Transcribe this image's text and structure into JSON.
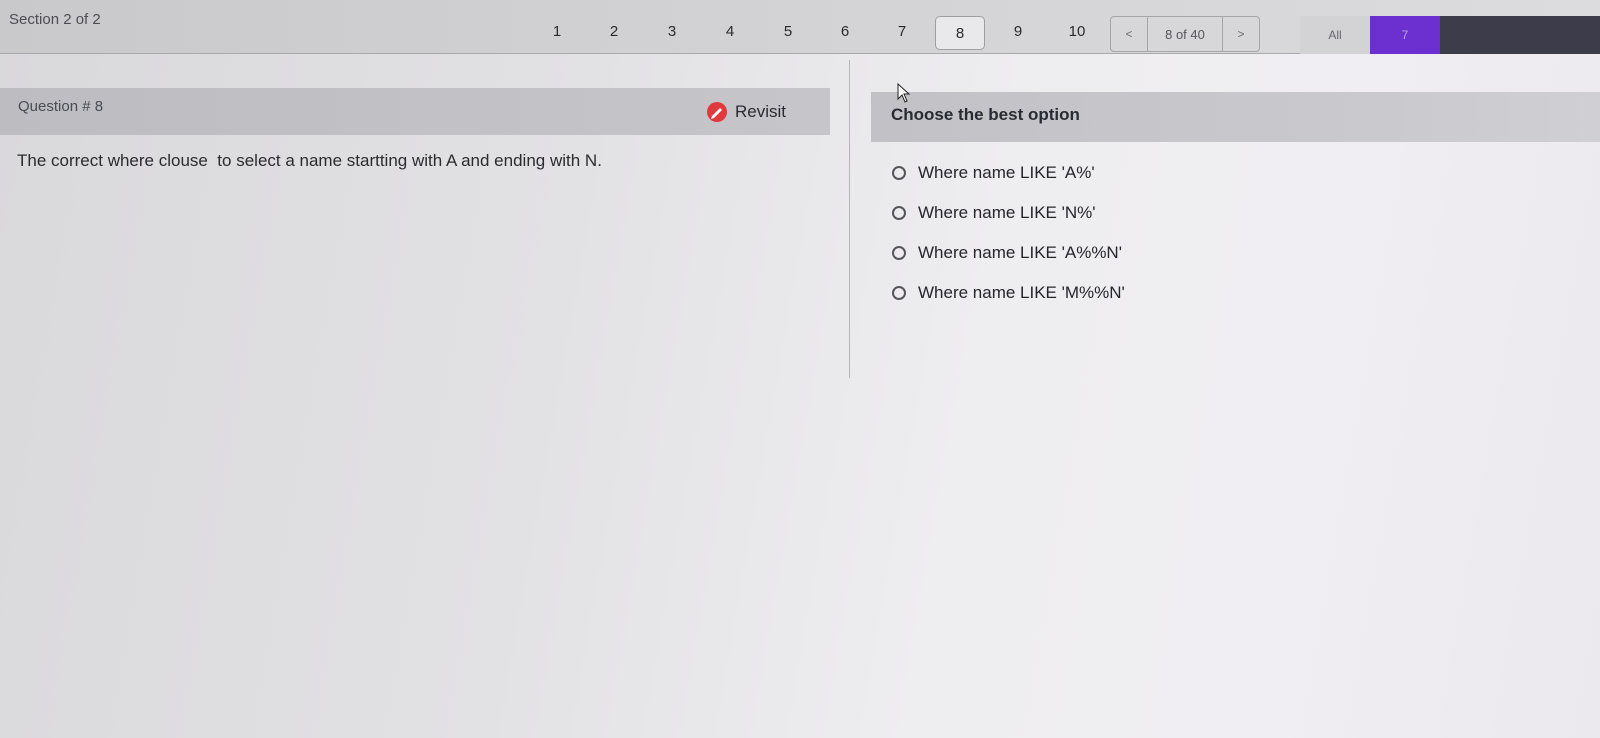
{
  "header": {
    "section_label": "Section 2 of 2",
    "question_numbers": [
      "1",
      "2",
      "3",
      "4",
      "5",
      "6",
      "7",
      "8",
      "9",
      "10"
    ],
    "active_question": "8",
    "pager": {
      "prev": "<",
      "count": "8 of 40",
      "next": ">"
    },
    "filters": {
      "all_label": "All",
      "count_label": "7"
    }
  },
  "question": {
    "title": "Question # 8",
    "revisit_label": "Revisit",
    "text": "The correct where clouse  to select a name startting with A and ending with N."
  },
  "answers": {
    "heading": "Choose the best option",
    "options": [
      "Where name LIKE 'A%'",
      "Where name LIKE 'N%'",
      "Where name LIKE 'A%%N'",
      "Where name LIKE 'M%%N'"
    ]
  },
  "colors": {
    "accent_purple": "#6c2fd0",
    "revisit_icon": "#e0393e"
  }
}
